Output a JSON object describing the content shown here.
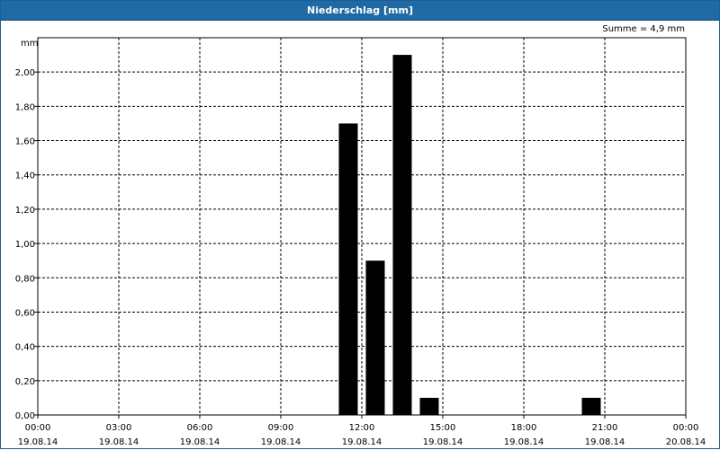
{
  "window": {
    "title": "Niederschlag [mm]"
  },
  "summary": "Summe = 4,9 mm",
  "chart_data": {
    "type": "bar",
    "title": "Niederschlag [mm]",
    "ylabel": "mm",
    "ylim": [
      0,
      2.2
    ],
    "yticks": [
      "0,00",
      "0,20",
      "0,40",
      "0,60",
      "0,80",
      "1,00",
      "1,20",
      "1,40",
      "1,60",
      "1,80",
      "2,00"
    ],
    "xlim_hours": [
      0,
      24
    ],
    "xticks": [
      {
        "time": "00:00",
        "date": "19.08.14"
      },
      {
        "time": "03:00",
        "date": "19.08.14"
      },
      {
        "time": "06:00",
        "date": "19.08.14"
      },
      {
        "time": "09:00",
        "date": "19.08.14"
      },
      {
        "time": "12:00",
        "date": "19.08.14"
      },
      {
        "time": "15:00",
        "date": "19.08.14"
      },
      {
        "time": "18:00",
        "date": "19.08.14"
      },
      {
        "time": "21:00",
        "date": "19.08.14"
      },
      {
        "time": "00:00",
        "date": "20.08.14"
      }
    ],
    "bars": [
      {
        "x_hour": 11.5,
        "value": 1.7
      },
      {
        "x_hour": 12.5,
        "value": 0.9
      },
      {
        "x_hour": 13.5,
        "value": 2.1
      },
      {
        "x_hour": 14.5,
        "value": 0.1
      },
      {
        "x_hour": 20.5,
        "value": 0.1
      }
    ],
    "grid": true,
    "bar_color": "#000000"
  }
}
